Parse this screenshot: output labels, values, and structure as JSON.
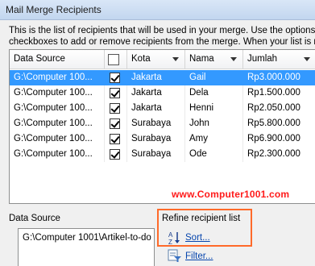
{
  "window": {
    "title": "Mail Merge Recipients"
  },
  "instructions": {
    "line1": "This is the list of recipients that will be used in your merge.  Use the options below to",
    "line2": "checkboxes to add or remove recipients from the merge.  When your list is ready, click OK"
  },
  "table": {
    "columns": [
      "Data Source",
      "",
      "Kota",
      "Nama",
      "Jumlah"
    ],
    "rows": [
      {
        "source": "G:\\Computer 100...",
        "checked": true,
        "kota": "Jakarta",
        "nama": "Gail",
        "jumlah": "Rp3.000.000",
        "selected": true
      },
      {
        "source": "G:\\Computer 100...",
        "checked": true,
        "kota": "Jakarta",
        "nama": "Dela",
        "jumlah": "Rp1.500.000",
        "selected": false
      },
      {
        "source": "G:\\Computer 100...",
        "checked": true,
        "kota": "Jakarta",
        "nama": "Henni",
        "jumlah": "Rp2.050.000",
        "selected": false
      },
      {
        "source": "G:\\Computer 100...",
        "checked": true,
        "kota": "Surabaya",
        "nama": "John",
        "jumlah": "Rp5.800.000",
        "selected": false
      },
      {
        "source": "G:\\Computer 100...",
        "checked": true,
        "kota": "Surabaya",
        "nama": "Amy",
        "jumlah": "Rp6.900.000",
        "selected": false
      },
      {
        "source": "G:\\Computer 100...",
        "checked": true,
        "kota": "Surabaya",
        "nama": "Ode",
        "jumlah": "Rp2.300.000",
        "selected": false
      }
    ]
  },
  "watermark": "www.Computer1001.com",
  "data_source_panel": {
    "label": "Data Source",
    "item": "G:\\Computer 1001\\Artikel-to-do"
  },
  "refine_panel": {
    "label": "Refine recipient list",
    "sort_label": "Sort...",
    "filter_label": "Filter..."
  },
  "colors": {
    "selection": "#3399ff",
    "highlight_rect": "#ff6a2a",
    "watermark": "#ff1a1a",
    "link": "#0645ad"
  },
  "icons": [
    "sort-az-icon",
    "filter-icon",
    "dropdown-arrow-icon",
    "checkbox-icon"
  ]
}
